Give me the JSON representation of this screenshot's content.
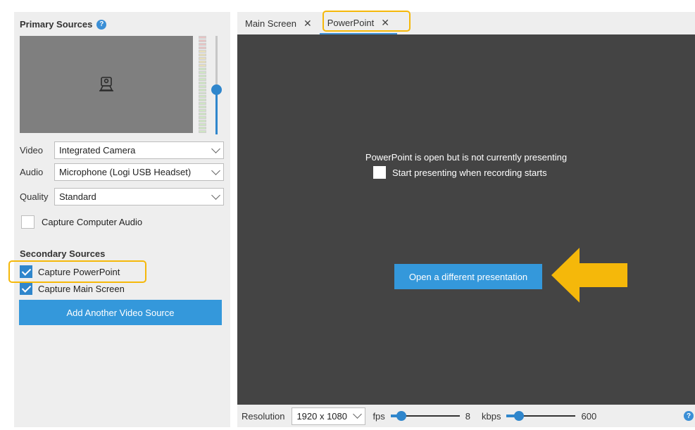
{
  "primary": {
    "title": "Primary Sources",
    "video_label": "Video",
    "video_value": "Integrated Camera",
    "audio_label": "Audio",
    "audio_value": "Microphone (Logi USB Headset)",
    "quality_label": "Quality",
    "quality_value": "Standard",
    "capture_audio_label": "Capture Computer Audio",
    "capture_audio_checked": false,
    "volume_level": 0.45,
    "preview_icon": "webcam-icon"
  },
  "secondary": {
    "title": "Secondary Sources",
    "capture_powerpoint_label": "Capture PowerPoint",
    "capture_powerpoint_checked": true,
    "capture_main_screen_label": "Capture Main Screen",
    "capture_main_screen_checked": true,
    "add_source_label": "Add Another Video Source"
  },
  "tabs": [
    {
      "label": "Main Screen",
      "active": false
    },
    {
      "label": "PowerPoint",
      "active": true
    }
  ],
  "stage": {
    "message": "PowerPoint is open but is not currently presenting",
    "start_presenting_label": "Start presenting when recording starts",
    "start_presenting_checked": false,
    "open_button_label": "Open a different presentation"
  },
  "bottom": {
    "resolution_label": "Resolution",
    "resolution_value": "1920 x 1080",
    "fps_label": "fps",
    "fps_value": "8",
    "fps_level": 0.15,
    "kbps_label": "kbps",
    "kbps_value": "600",
    "kbps_level": 0.18
  },
  "colors": {
    "accent": "#3498db",
    "highlight": "#f5b80a",
    "stage_bg": "#444444"
  }
}
